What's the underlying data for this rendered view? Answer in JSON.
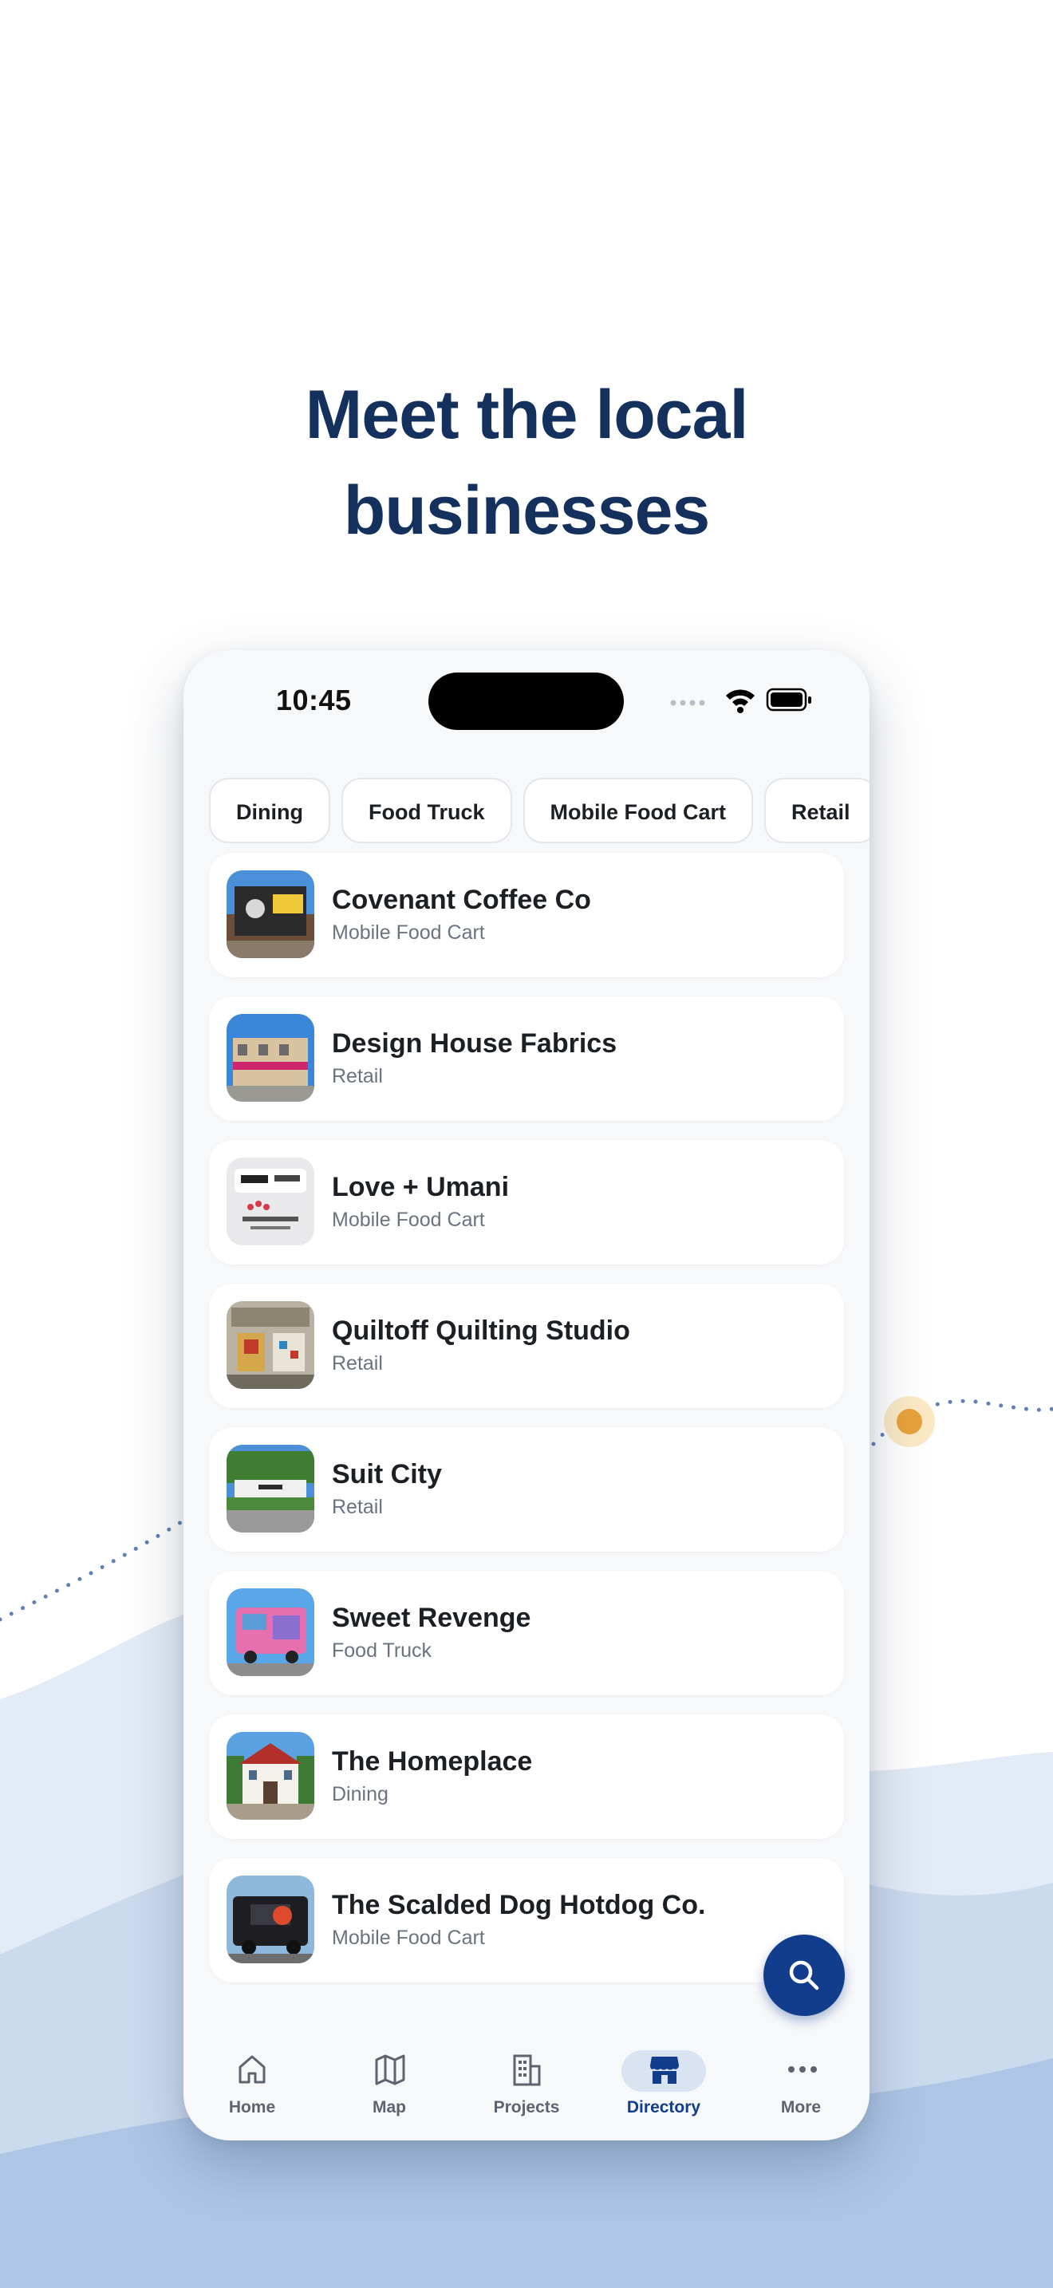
{
  "headline": {
    "line1": "Meet the local",
    "line2": "businesses"
  },
  "status_bar": {
    "time": "10:45"
  },
  "filters": [
    "Dining",
    "Food Truck",
    "Mobile Food Cart",
    "Retail"
  ],
  "businesses": [
    {
      "name": "Covenant Coffee Co",
      "category": "Mobile Food Cart"
    },
    {
      "name": "Design House Fabrics",
      "category": "Retail"
    },
    {
      "name": "Love + Umani",
      "category": "Mobile Food Cart"
    },
    {
      "name": "Quiltoff Quilting Studio",
      "category": "Retail"
    },
    {
      "name": "Suit City",
      "category": "Retail"
    },
    {
      "name": "Sweet Revenge",
      "category": "Food Truck"
    },
    {
      "name": "The Homeplace",
      "category": "Dining"
    },
    {
      "name": "The Scalded Dog Hotdog Co.",
      "category": "Mobile Food Cart"
    }
  ],
  "tabs": [
    {
      "label": "Home",
      "icon": "home-icon"
    },
    {
      "label": "Map",
      "icon": "map-icon"
    },
    {
      "label": "Projects",
      "icon": "building-icon"
    },
    {
      "label": "Directory",
      "icon": "storefront-icon",
      "active": true
    },
    {
      "label": "More",
      "icon": "more-icon"
    }
  ],
  "colors": {
    "brand": "#14305c",
    "accent": "#123d8c",
    "highlight": "#e8a23a",
    "wave_light": "#e3ebf6",
    "wave_dark": "#adc6e6"
  }
}
